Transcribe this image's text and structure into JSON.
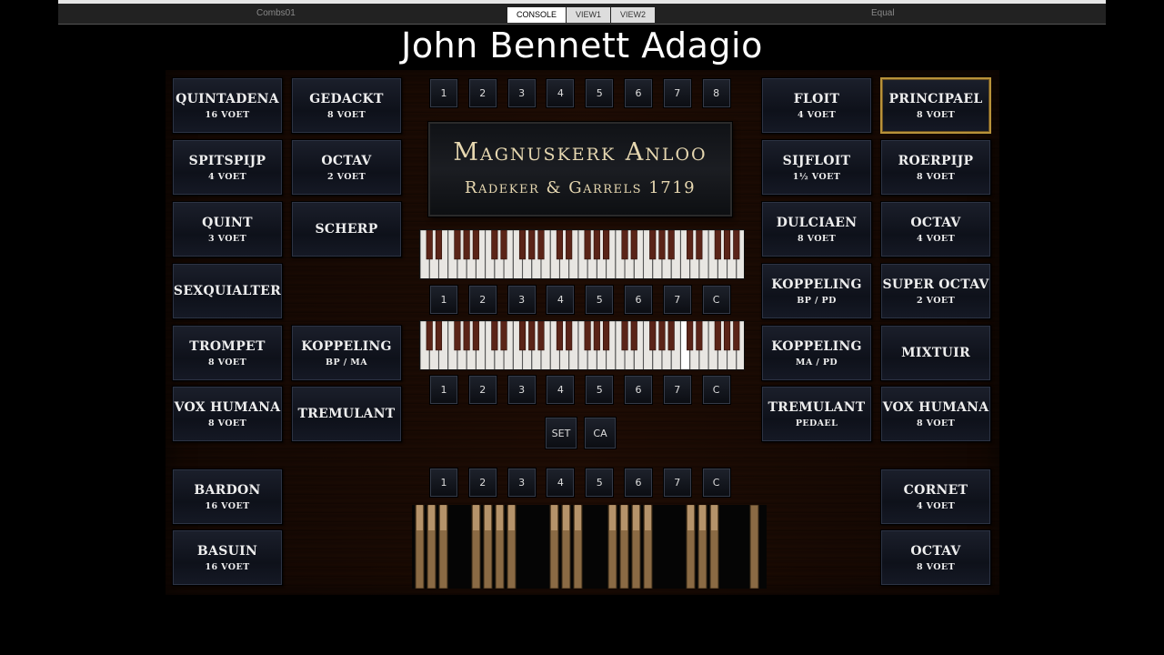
{
  "toolbar": {
    "left_label": "Combs01",
    "right_label": "Equal",
    "tabs": [
      "CONSOLE",
      "VIEW1",
      "VIEW2"
    ]
  },
  "title": "John Bennett Adagio",
  "plaque": {
    "line1": "Magnuskerk   Anloo",
    "line2": "Radeker & Garrels  1719"
  },
  "stops_left": [
    {
      "name": "QUINTADENA",
      "foot": "16 VOET"
    },
    {
      "name": "GEDACKT",
      "foot": "8 VOET"
    },
    {
      "name": "SPITSPIJP",
      "foot": "4 VOET"
    },
    {
      "name": "OCTAV",
      "foot": "2 VOET"
    },
    {
      "name": "QUINT",
      "foot": "3 VOET"
    },
    {
      "name": "SCHERP",
      "foot": ""
    },
    {
      "name": "SEXQUIALTER",
      "foot": ""
    },
    {
      "name": "TROMPET",
      "foot": "8 VOET"
    },
    {
      "name": "KOPPELING",
      "foot": "BP / MA"
    },
    {
      "name": "VOX HUMANA",
      "foot": "8 VOET"
    },
    {
      "name": "TREMULANT",
      "foot": ""
    },
    {
      "name": "BARDON",
      "foot": "16 VOET"
    },
    {
      "name": "BASUIN",
      "foot": "16 VOET"
    }
  ],
  "stops_right": [
    {
      "name": "FLOIT",
      "foot": "4 VOET"
    },
    {
      "name": "PRINCIPAEL",
      "foot": "8 VOET",
      "active": true
    },
    {
      "name": "SIJFLOIT",
      "foot": "1½ VOET"
    },
    {
      "name": "ROERPIJP",
      "foot": "8 VOET"
    },
    {
      "name": "DULCIAEN",
      "foot": "8 VOET"
    },
    {
      "name": "OCTAV",
      "foot": "4 VOET"
    },
    {
      "name": "KOPPELING",
      "foot": "BP / PD"
    },
    {
      "name": "SUPER OCTAV",
      "foot": "2 VOET"
    },
    {
      "name": "KOPPELING",
      "foot": "MA / PD"
    },
    {
      "name": "MIXTUIR",
      "foot": ""
    },
    {
      "name": "TREMULANT",
      "foot": "PEDAEL"
    },
    {
      "name": "VOX HUMANA",
      "foot": "8 VOET"
    },
    {
      "name": "CORNET",
      "foot": "4 VOET"
    },
    {
      "name": "OCTAV",
      "foot": "8 VOET"
    }
  ],
  "pistons": {
    "top": [
      "1",
      "2",
      "3",
      "4",
      "5",
      "6",
      "7",
      "8"
    ],
    "row_mid1": [
      "1",
      "2",
      "3",
      "4",
      "5",
      "6",
      "7",
      "C"
    ],
    "row_mid2": [
      "1",
      "2",
      "3",
      "4",
      "5",
      "6",
      "7",
      "C"
    ],
    "row_pedal": [
      "1",
      "2",
      "3",
      "4",
      "5",
      "6",
      "7",
      "C"
    ],
    "set": "SET",
    "ca": "CA"
  },
  "colors": {
    "wood": "#4a2e1a",
    "stop_face": "#141824",
    "active_border": "#b8923a"
  }
}
